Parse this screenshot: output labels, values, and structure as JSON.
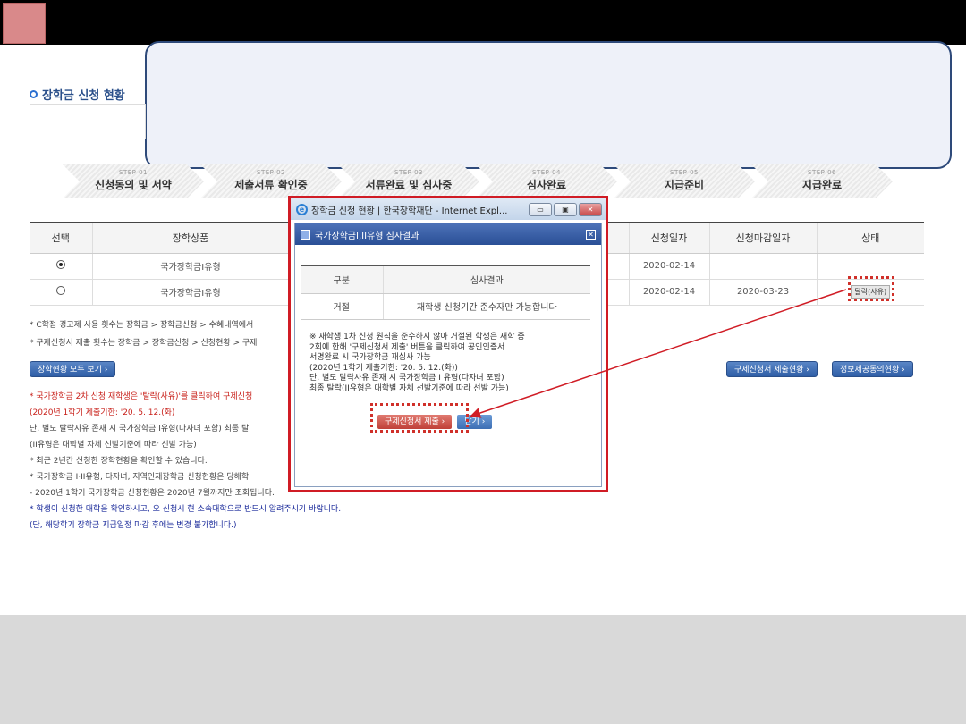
{
  "section_title": "장학금 신청 현황",
  "steps": [
    {
      "num": "STEP 01",
      "name": "신청동의 및 서약"
    },
    {
      "num": "STEP 02",
      "name": "제출서류 확인중"
    },
    {
      "num": "STEP 03",
      "name": "서류완료 및 심사중"
    },
    {
      "num": "STEP 04",
      "name": "심사완료"
    },
    {
      "num": "STEP 05",
      "name": "지급준비"
    },
    {
      "num": "STEP 06",
      "name": "지급완료"
    }
  ],
  "table": {
    "headers": [
      "선택",
      "장학상품",
      "신청일자",
      "신청마감일자",
      "상태"
    ],
    "rows": [
      {
        "product": "국가장학금I유형",
        "date": "2020-02-14",
        "deadline": "",
        "status": ""
      },
      {
        "product": "국가장학금I유형",
        "date": "2020-02-14",
        "deadline": "2020-03-23",
        "status": "탈락(사유)"
      }
    ]
  },
  "notes": [
    "* C학점 경고제 사용 횟수는 장학금 > 장학금신청 > 수혜내역에서",
    "* 구제신청서 제출 횟수는 장학금 > 장학금신청 > 신청현황 > 구제"
  ],
  "buttons": {
    "view_all": "장학현황 모두 보기 ›",
    "relief_status": "구제신청서 제출현황 ›",
    "consent_status": "정보제공동의현황 ›"
  },
  "lower_notes": [
    {
      "cls": "red",
      "text": "* 국가장학금 2차 신청 재학생은 '탈락(사유)'를 클릭하여 구제신청"
    },
    {
      "cls": "red",
      "text": "  (2020년 1학기 제출기한: '20. 5. 12.(화)"
    },
    {
      "cls": "dark",
      "text": "  단, 별도 탈락사유 존재 시 국가장학금 I유형(다자녀 포함) 최종 탈"
    },
    {
      "cls": "dark",
      "text": "  (II유형은 대학별 자체 선발기준에 따라 선발 가능)"
    },
    {
      "cls": "dark",
      "text": "* 최근 2년간 신청한 장학현황을 확인할 수 있습니다."
    },
    {
      "cls": "dark",
      "text": "* 국가장학금 I·II유형, 다자녀, 지역인재장학금 신청현황은 당해학"
    },
    {
      "cls": "dark",
      "text": "  - 2020년 1학기 국가장학금 신청현황은 2020년 7월까지만 조회됩니다."
    },
    {
      "cls": "blue",
      "text": "* 학생이 신청한 대학을 확인하시고, 오 신청시 현 소속대학으로 반드시 알려주시기 바랍니다."
    },
    {
      "cls": "blue",
      "text": "  (단, 해당학기 장학금 지급일정 마감 후에는 변경 불가합니다.)"
    }
  ],
  "popup": {
    "window_title": "장학금 신청 현황 | 한국장학재단 - Internet Expl...",
    "header": "국가장학금I,II유형 심사결과",
    "col1": "구분",
    "col2": "심사결과",
    "row_label": "거절",
    "row_value": "재학생 신청기간 준수자만 가능합니다",
    "notice": "※ 재학생 1차 신청 원칙을 준수하지 않아 거절된 학생은 재학 중\n  2회에 한해 '구제신청서 제출' 버튼을 클릭하여 공인인증서\n  서명완료 시 국가장학금 재심사 가능\n  (2020년 1학기 제출기한: '20. 5. 12.(화))\n  단, 별도 탈락사유 존재 시 국가장학금 I 유형(다자녀 포함)\n  최종 탈락(II유형은 대학별 자체 선발기준에 따라 선발 가능)",
    "submit_btn": "구제신청서 제출 ›",
    "close_btn": "닫기 ›"
  },
  "colors": {
    "accent": "#d01c25",
    "brand_blue": "#2a4f8a"
  }
}
